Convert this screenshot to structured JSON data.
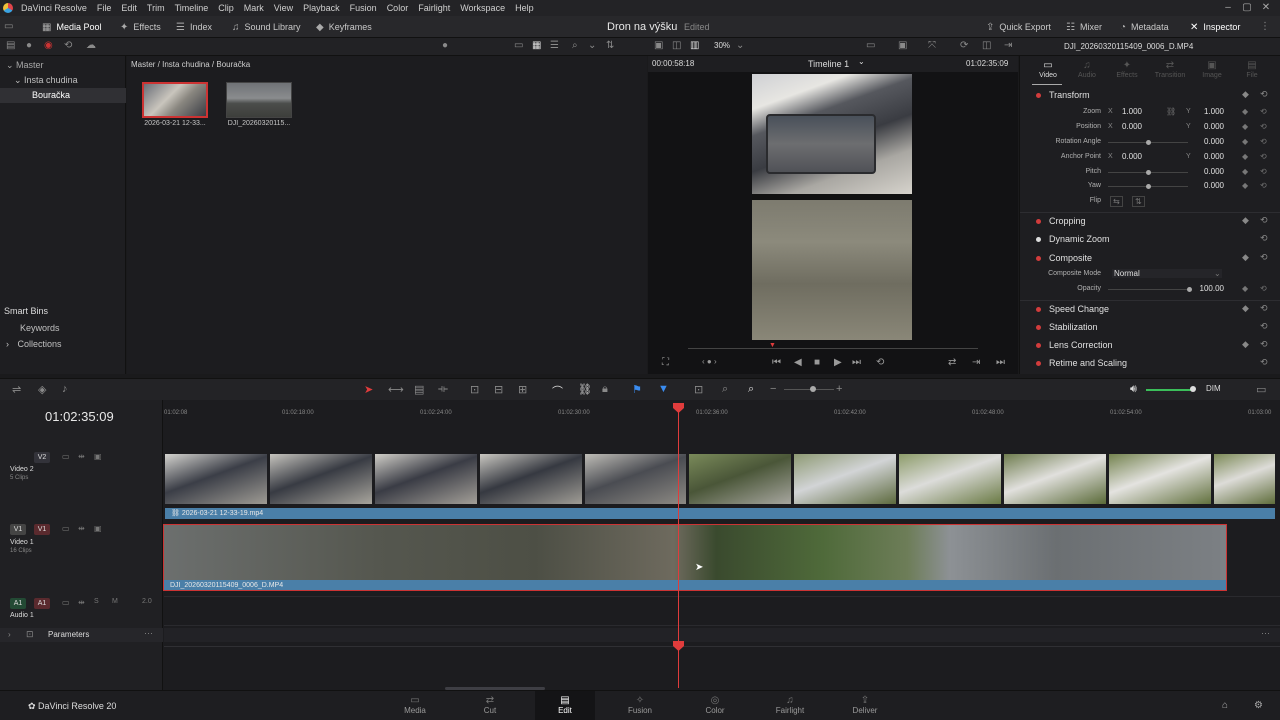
{
  "app": {
    "menu": [
      "DaVinci Resolve",
      "File",
      "Edit",
      "Trim",
      "Timeline",
      "Clip",
      "Mark",
      "View",
      "Playback",
      "Fusion",
      "Color",
      "Fairlight",
      "Workspace",
      "Help"
    ]
  },
  "toolbar": {
    "media_pool": "Media Pool",
    "effects": "Effects",
    "index": "Index",
    "sound_library": "Sound Library",
    "keyframes": "Keyframes",
    "project_title": "Dron na výšku",
    "project_state": "Edited",
    "quick_export": "Quick Export",
    "mixer": "Mixer",
    "metadata": "Metadata",
    "inspector": "Inspector"
  },
  "viewer_zoom": "30%",
  "bins": {
    "master": "Master",
    "sub1": "Insta chudina",
    "sub2": "Bouračka",
    "smart_bins": "Smart Bins",
    "keywords": "Keywords",
    "collections": "Collections"
  },
  "pool": {
    "path": "Master / Insta chudina / Bouračka",
    "clips": [
      {
        "name": "2026-03-21 12-33..."
      },
      {
        "name": "DJI_20260320115..."
      }
    ]
  },
  "viewer": {
    "source_tc": "00:00:58:18",
    "timeline_name": "Timeline 1",
    "record_tc": "01:02:35:09"
  },
  "inspector": {
    "file": "DJI_20260320115409_0006_D.MP4",
    "tabs": [
      "Video",
      "Audio",
      "Effects",
      "Transition",
      "Image",
      "File"
    ],
    "transform_title": "Transform",
    "zoom_label": "Zoom",
    "zoom_x": "1.000",
    "zoom_y": "1.000",
    "position_label": "Position",
    "position_x": "0.000",
    "position_y": "0.000",
    "rotation_label": "Rotation Angle",
    "rotation": "0.000",
    "anchor_label": "Anchor Point",
    "anchor_x": "0.000",
    "anchor_y": "0.000",
    "pitch_label": "Pitch",
    "pitch": "0.000",
    "yaw_label": "Yaw",
    "yaw": "0.000",
    "flip_label": "Flip",
    "axis_x": "X",
    "axis_y": "Y",
    "cropping": "Cropping",
    "dynamic_zoom": "Dynamic Zoom",
    "composite": "Composite",
    "composite_mode_label": "Composite Mode",
    "composite_mode": "Normal",
    "opacity_label": "Opacity",
    "opacity": "100.00",
    "speed_change": "Speed Change",
    "stabilization": "Stabilization",
    "lens_correction": "Lens Correction",
    "retime_scaling": "Retime and Scaling"
  },
  "timeline": {
    "timecode": "01:02:35:09",
    "ruler": [
      "01:02:08",
      "01:02:18:00",
      "01:02:24:00",
      "01:02:30:00",
      "01:02:36:00",
      "01:02:42:00",
      "01:02:48:00",
      "01:02:54:00",
      "01:03:00"
    ],
    "tracks": {
      "v2_badge": "V2",
      "v2_name": "Video 2",
      "v2_clips": "5 Clips",
      "v1_badge_src": "V1",
      "v1_badge": "V1",
      "v1_name": "Video 1",
      "v1_clips": "16 Clips",
      "a1_badge_src": "A1",
      "a1_badge": "A1",
      "a1_name": "Audio 1",
      "a1_level": "2.0",
      "a1_solo": "S",
      "a1_mute": "M"
    },
    "v2_clip": "2026-03-21 12-33-19.mp4",
    "v1_clip": "DJI_20260320115409_0006_D.MP4",
    "parameters": "Parameters",
    "dim_label": "DIM"
  },
  "pages": {
    "brand": "DaVinci Resolve 20",
    "items": [
      "Media",
      "Cut",
      "Edit",
      "Fusion",
      "Color",
      "Fairlight",
      "Deliver"
    ],
    "active": "Edit"
  },
  "colors": {
    "accent_red": "#e03c3c",
    "clip_bar_blue": "#4a7fa8",
    "playhead": "#e03c3c"
  }
}
